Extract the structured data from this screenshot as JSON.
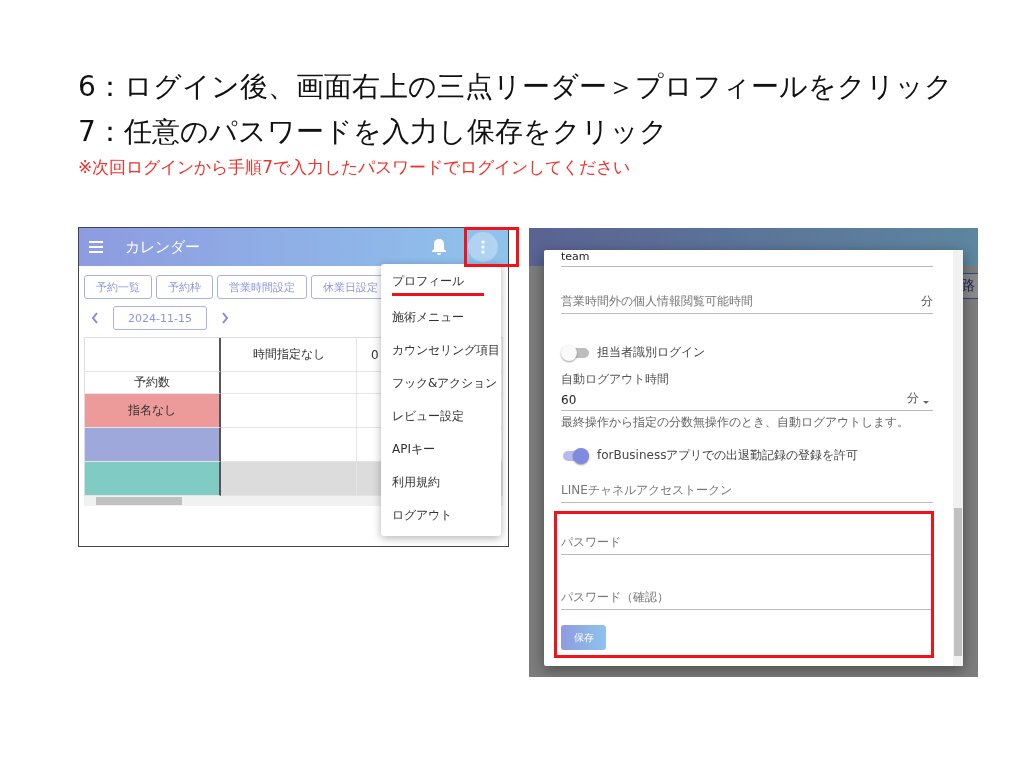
{
  "slide": {
    "steps": [
      "6：ログイン後、画面右上の三点リーダー＞プロフィールをクリック",
      "7：任意のパスワードを入力し保存をクリック"
    ],
    "note": "※次回ログインから手順7で入力したパスワードでログインしてください"
  },
  "calendar_screen": {
    "app_bar": {
      "title": "カレンダー"
    },
    "nav_buttons": [
      "予約一覧",
      "予約枠",
      "営業時間設定",
      "休業日設定"
    ],
    "date": "2024-11-15",
    "table": {
      "columns": [
        "",
        "時間指定なし",
        "0"
      ],
      "rows": [
        {
          "label": "予約数",
          "color": "#ffffff",
          "disabled": false
        },
        {
          "label": "指名なし",
          "color": "#ec9a9a",
          "disabled": false
        },
        {
          "label": "",
          "color": "#9fa8da",
          "disabled": false
        },
        {
          "label": "",
          "color": "#80cbc4",
          "disabled": true
        }
      ]
    },
    "menu": {
      "items": [
        {
          "label": "プロフィール",
          "highlighted": true
        },
        {
          "label": "施術メニュー",
          "highlighted": false
        },
        {
          "label": "カウンセリング項目",
          "highlighted": false
        },
        {
          "label": "フック&アクション",
          "highlighted": false
        },
        {
          "label": "レビュー設定",
          "highlighted": false
        },
        {
          "label": "APIキー",
          "highlighted": false
        },
        {
          "label": "利用規約",
          "highlighted": false
        },
        {
          "label": "ログアウト",
          "highlighted": false
        }
      ]
    }
  },
  "profile_screen": {
    "side_button": "路",
    "fields": [
      {
        "kind": "text",
        "value": "team"
      },
      {
        "kind": "text",
        "placeholder": "営業時間外の個人情報閲覧可能時間",
        "suffix": "分"
      },
      {
        "kind": "switch",
        "label": "担当者識別ログイン",
        "on": false
      },
      {
        "kind": "select",
        "label": "自動ログアウト時間",
        "value": "60",
        "suffix": "分",
        "hint": "最終操作から指定の分数無操作のとき、自動ログアウトします。"
      },
      {
        "kind": "switch",
        "label": "forBusinessアプリでの出退勤記録の登録を許可",
        "on": true
      },
      {
        "kind": "text",
        "placeholder": "LINEチャネルアクセストークン"
      }
    ],
    "password_section": {
      "fields": [
        {
          "placeholder": "パスワード"
        },
        {
          "placeholder": "パスワード（確認）"
        }
      ],
      "save_button": "保存"
    }
  }
}
